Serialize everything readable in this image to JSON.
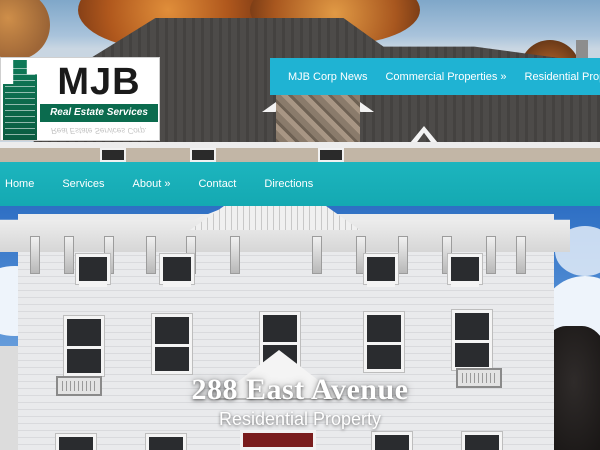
{
  "logo": {
    "mark": "MJB",
    "tagline": "Real Estate Services Corp.",
    "reflection": "Real Estate Services Corp."
  },
  "top_nav": [
    {
      "label": "MJB Corp News"
    },
    {
      "label": "Commercial Properties »"
    },
    {
      "label": "Residential Properties"
    }
  ],
  "main_nav": [
    {
      "label": "Home"
    },
    {
      "label": "Services"
    },
    {
      "label": "About »"
    },
    {
      "label": "Contact"
    },
    {
      "label": "Directions"
    }
  ],
  "hero": {
    "title": "288 East Avenue",
    "subtitle": "Residential Property"
  },
  "colors": {
    "top_nav_bg": "#1fb3d3",
    "main_nav_bg": "#1db5be",
    "logo_green": "#0b6b4e"
  }
}
